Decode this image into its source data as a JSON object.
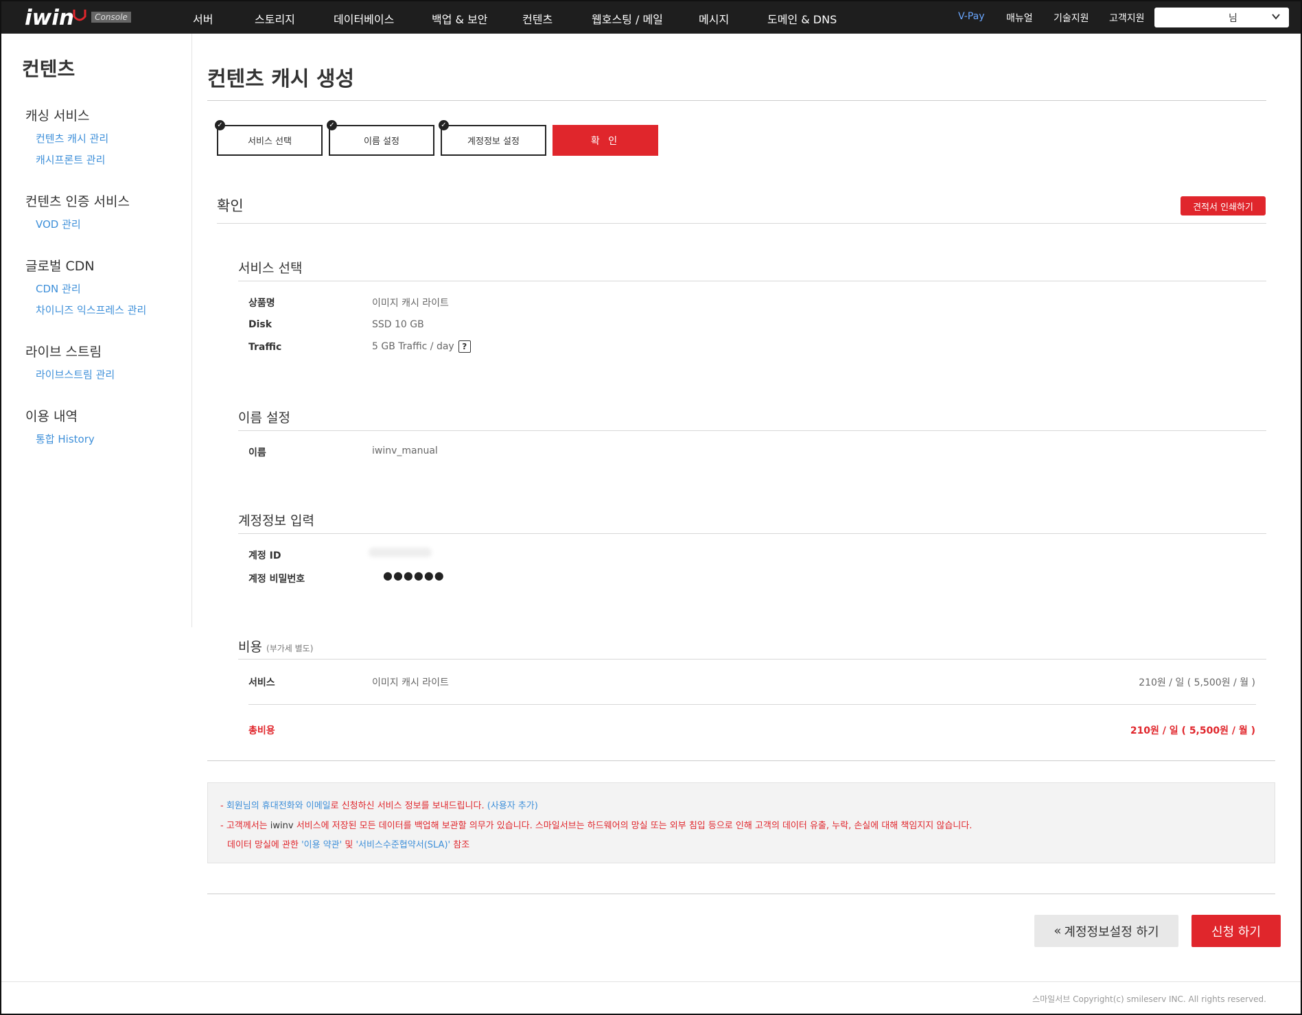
{
  "header": {
    "logo_text": "iwin",
    "console_label": "Console",
    "nav": [
      "서버",
      "스토리지",
      "데이터베이스",
      "백업 & 보안",
      "컨텐츠",
      "웹호스팅 / 메일",
      "메시지",
      "도메인 & DNS"
    ],
    "util": [
      "V-Pay",
      "매뉴얼",
      "기술지원",
      "고객지원"
    ],
    "user_label": "님"
  },
  "sidebar": {
    "title": "컨텐츠",
    "groups": [
      {
        "label": "캐싱 서비스",
        "links": [
          "컨텐츠 캐시 관리",
          "캐시프론트 관리"
        ]
      },
      {
        "label": "컨텐츠 인증 서비스",
        "links": [
          "VOD 관리"
        ]
      },
      {
        "label": "글로벌 CDN",
        "links": [
          "CDN 관리",
          "차이니즈 익스프레스 관리"
        ]
      },
      {
        "label": "라이브 스트림",
        "links": [
          "라이브스트림 관리"
        ]
      },
      {
        "label": "이용 내역",
        "links": [
          "통합 History"
        ]
      }
    ]
  },
  "main": {
    "title": "컨텐츠 캐시 생성",
    "steps": [
      "서비스 선택",
      "이름 설정",
      "계정정보 설정",
      "확 인"
    ],
    "section_title": "확인",
    "print_button": "견적서 인쇄하기",
    "service": {
      "title": "서비스 선택",
      "rows": [
        {
          "label": "상품명",
          "value": "이미지 캐시 라이트"
        },
        {
          "label": "Disk",
          "value": "SSD 10 GB"
        },
        {
          "label": "Traffic",
          "value": "5 GB Traffic / day"
        }
      ],
      "help_icon": "?"
    },
    "name": {
      "title": "이름 설정",
      "label": "이름",
      "value": "iwinv_manual"
    },
    "account": {
      "title": "계정정보 입력",
      "id_label": "계정 ID",
      "pw_label": "계정 비밀번호",
      "pw_value": "●●●●●●"
    },
    "cost": {
      "title": "비용",
      "note": "(부가세 별도)",
      "service_label": "서비스",
      "service_value": "이미지 캐시 라이트",
      "service_price": "210원 / 일 ( 5,500원 / 월 )",
      "total_label": "총비용",
      "total_price": "210원 / 일 ( 5,500원 / 월 )"
    },
    "notice": {
      "l1_a": "- ",
      "l1_b": "회원님의 휴대전화와 이메일",
      "l1_c": "로 신청하신 서비스 정보를 보내드립니다. ",
      "l1_d": "(사용자 추가)",
      "l2_a": "- 고객께서는 ",
      "l2_b": "iwinv",
      "l2_c": " 서비스에 저장된 모든 데이터를 백업해 보관할 의무가 있습니다. 스마일서브는 하드웨어의 망실 또는 외부 침입 등으로 인해 고객의 데이터 유출, 누락, 손실에 대해 책임지지 않습니다.",
      "l3_a": "데이터 망실에 관한 ",
      "l3_b": "'이용 약관'",
      "l3_c": " 및 ",
      "l3_d": "'서비스수준협약서(SLA)'",
      "l3_e": " 참조"
    },
    "back_button": "계정정보설정 하기",
    "apply_button": "신청 하기"
  },
  "footer": "스마일서브 Copyright(c) smileserv INC. All rights reserved.",
  "colors": {
    "accent": "#e0262c",
    "link": "#3d8fd9",
    "nav_bg": "#1e1e1e"
  }
}
